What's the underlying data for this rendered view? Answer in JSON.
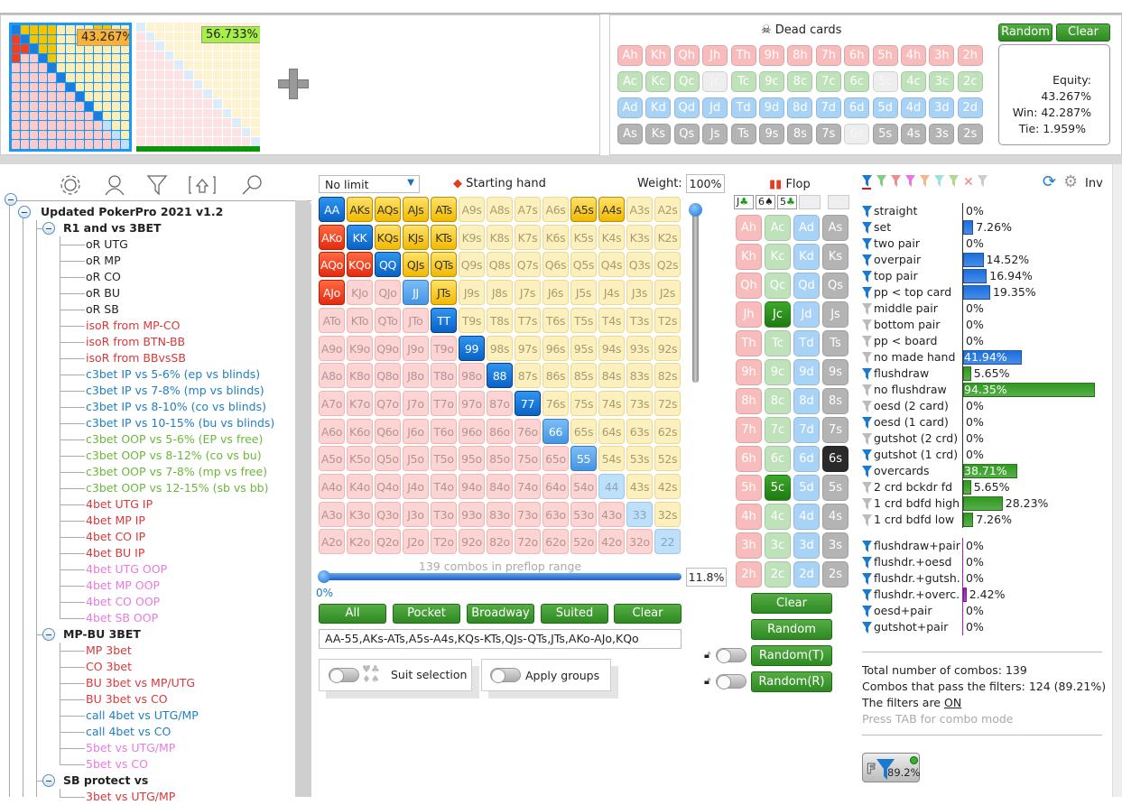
{
  "range_panel": {
    "hero_equity_label": "43.267%",
    "villain_equity_label": "56.733%",
    "add_icon": "plus-icon"
  },
  "dead_cards": {
    "title": "Dead cards",
    "icon": "skull-icon",
    "random_label": "Random",
    "clear_label": "Clear",
    "rows": [
      [
        "Ah",
        "Kh",
        "Qh",
        "Jh",
        "Th",
        "9h",
        "8h",
        "7h",
        "6h",
        "5h",
        "4h",
        "3h",
        "2h"
      ],
      [
        "Ac",
        "Kc",
        "Qc",
        "Jc",
        "Tc",
        "9c",
        "8c",
        "7c",
        "6c",
        "5c",
        "4c",
        "3c",
        "2c"
      ],
      [
        "Ad",
        "Kd",
        "Qd",
        "Jd",
        "Td",
        "9d",
        "8d",
        "7d",
        "6d",
        "5d",
        "4d",
        "3d",
        "2d"
      ],
      [
        "As",
        "Ks",
        "Qs",
        "Js",
        "Ts",
        "9s",
        "8s",
        "7s",
        "6s",
        "5s",
        "4s",
        "3s",
        "2s"
      ]
    ],
    "unavailable": [
      "Jc",
      "5c",
      "6s"
    ],
    "equity": "Equity: 43.267%",
    "win": "Win: 42.287%",
    "tie": "Tie: 1.959%"
  },
  "toolbar_icons": [
    "gear-icon",
    "user-icon",
    "filter-icon",
    "upload-icon",
    "search-icon"
  ],
  "tree": {
    "root": "Updated PokerPro 2021 v1.2",
    "groups": [
      {
        "label": "R1 and vs 3BET",
        "items": [
          {
            "t": "oR UTG",
            "c": "#222"
          },
          {
            "t": "oR MP",
            "c": "#222"
          },
          {
            "t": "oR CO",
            "c": "#222"
          },
          {
            "t": "oR BU",
            "c": "#222"
          },
          {
            "t": "oR SB",
            "c": "#222"
          },
          {
            "t": "isoR from MP-CO",
            "c": "#d9383a"
          },
          {
            "t": "isoR from BTN-BB",
            "c": "#d9383a"
          },
          {
            "t": "isoR from BBvsSB",
            "c": "#d9383a"
          },
          {
            "t": "c3bet IP vs 5-6% (ep vs blinds)",
            "c": "#1f7fc0"
          },
          {
            "t": "c3bet IP vs 7-8% (mp vs blinds)",
            "c": "#1f7fc0"
          },
          {
            "t": "c3bet IP vs 8-10% (co vs blinds)",
            "c": "#1f7fc0"
          },
          {
            "t": "c3bet IP vs 10-15% (bu vs blinds)",
            "c": "#1f7fc0"
          },
          {
            "t": "c3bet OOP vs 5-6% (EP vs free)",
            "c": "#6bb83a"
          },
          {
            "t": "c3bet OOP vs 8-12% (co vs bu)",
            "c": "#6bb83a"
          },
          {
            "t": "c3bet OOP vs 7-8% (mp vs free)",
            "c": "#6bb83a"
          },
          {
            "t": "c3bet OOP vs 12-15% (sb vs bb)",
            "c": "#6bb83a"
          },
          {
            "t": "4bet UTG IP",
            "c": "#d9383a"
          },
          {
            "t": "4bet MP IP",
            "c": "#d9383a"
          },
          {
            "t": "4bet CO IP",
            "c": "#d9383a"
          },
          {
            "t": "4bet BU IP",
            "c": "#d9383a"
          },
          {
            "t": "4bet UTG OOP",
            "c": "#e87ae0"
          },
          {
            "t": "4bet MP OOP",
            "c": "#e87ae0"
          },
          {
            "t": "4bet CO OOP",
            "c": "#e87ae0"
          },
          {
            "t": "4bet SB OOP",
            "c": "#e87ae0"
          }
        ]
      },
      {
        "label": "MP-BU 3BET",
        "items": [
          {
            "t": "MP 3bet",
            "c": "#d9383a"
          },
          {
            "t": "CO 3bet",
            "c": "#d9383a"
          },
          {
            "t": "BU 3bet vs MP/UTG",
            "c": "#d9383a"
          },
          {
            "t": "BU 3bet vs CO",
            "c": "#d9383a"
          },
          {
            "t": "call 4bet vs UTG/MP",
            "c": "#1f7fc0"
          },
          {
            "t": "call 4bet vs CO",
            "c": "#1f7fc0"
          },
          {
            "t": "5bet vs UTG/MP",
            "c": "#e87ae0"
          },
          {
            "t": "5bet vs CO",
            "c": "#e87ae0"
          }
        ]
      },
      {
        "label": "SB protect vs",
        "items": [
          {
            "t": "3bet vs UTG/MP",
            "c": "#d9383a"
          }
        ]
      }
    ]
  },
  "range_editor": {
    "limit_select": "No limit",
    "starting_hand_label": "Starting hand",
    "weight_label": "Weight:",
    "weight_value": "100%",
    "ranks": [
      "A",
      "K",
      "Q",
      "J",
      "T",
      "9",
      "8",
      "7",
      "6",
      "5",
      "4",
      "3",
      "2"
    ],
    "selected": [
      "AA",
      "KK",
      "QQ",
      "TT",
      "99",
      "88",
      "77",
      "AKs",
      "AQs",
      "AJs",
      "ATs",
      "A5s",
      "A4s",
      "KQs",
      "KJs",
      "KTs",
      "QJs",
      "QTs",
      "JTs",
      "AKo",
      "AQo",
      "KQo",
      "AJo"
    ],
    "partial": [
      "JJ",
      "66",
      "55"
    ],
    "combos_label": "139 combos in preflop range",
    "slider_value": "11.8%",
    "slider_min": "0%",
    "buttons": [
      "All",
      "Pocket",
      "Broadway",
      "Suited",
      "Clear"
    ],
    "range_text": "AA-55,AKs-ATs,A5s-A4s,KQs-KTs,QJs-QTs,JTs,AKo-AJo,KQo",
    "suit_selection_label": "Suit selection",
    "apply_groups_label": "Apply groups"
  },
  "flop": {
    "title": "Flop",
    "board": [
      {
        "r": "J",
        "s": "♣",
        "color": "#1a9a1a"
      },
      {
        "r": "6",
        "s": "♠",
        "color": "#222"
      },
      {
        "r": "5",
        "s": "♣",
        "color": "#1a9a1a"
      }
    ],
    "selected": [
      "Jc",
      "5c",
      "6s"
    ],
    "buttons": {
      "clear": "Clear",
      "random": "Random",
      "random_t": "Random(T)",
      "random_r": "Random(R)"
    }
  },
  "stats": {
    "inv_label": "Inv",
    "filter_colors": [
      "#1a7ad0",
      "#8ac88a",
      "#e89090",
      "#e07ae0",
      "#f0b890",
      "#a0e0e0",
      "#b0d890",
      "#f08080",
      "#cccccc"
    ],
    "groups": [
      {
        "color": "#1a6fe0",
        "rows": [
          {
            "label": "straight",
            "value": "0%",
            "pct": 0,
            "on": true
          },
          {
            "label": "set",
            "value": "7.26%",
            "pct": 7.26,
            "on": true
          },
          {
            "label": "two pair",
            "value": "0%",
            "pct": 0,
            "on": true
          },
          {
            "label": "overpair",
            "value": "14.52%",
            "pct": 14.52,
            "on": true
          },
          {
            "label": "top pair",
            "value": "16.94%",
            "pct": 16.94,
            "on": true
          },
          {
            "label": "pp < top card",
            "value": "19.35%",
            "pct": 19.35,
            "on": true
          },
          {
            "label": "middle pair",
            "value": "0%",
            "pct": 0,
            "on": false
          },
          {
            "label": "bottom pair",
            "value": "0%",
            "pct": 0,
            "on": false
          },
          {
            "label": "pp < board",
            "value": "0%",
            "pct": 0,
            "on": false
          },
          {
            "label": "no made hand",
            "value": "41.94%",
            "pct": 41.94,
            "on": false
          }
        ]
      },
      {
        "color": "#2e9a1e",
        "rows": [
          {
            "label": "flushdraw",
            "value": "5.65%",
            "pct": 5.65,
            "on": true
          },
          {
            "label": "no flushdraw",
            "value": "94.35%",
            "pct": 94.35,
            "on": false
          },
          {
            "label": "oesd (2 card)",
            "value": "0%",
            "pct": 0,
            "on": false
          },
          {
            "label": "oesd (1 card)",
            "value": "0%",
            "pct": 0,
            "on": true
          },
          {
            "label": "gutshot (2 crd)",
            "value": "0%",
            "pct": 0,
            "on": false
          },
          {
            "label": "gutshot (1 crd)",
            "value": "0%",
            "pct": 0,
            "on": true
          },
          {
            "label": "overcards",
            "value": "38.71%",
            "pct": 38.71,
            "on": true
          },
          {
            "label": "2 crd bckdr fd",
            "value": "5.65%",
            "pct": 5.65,
            "on": false
          },
          {
            "label": "1 crd bdfd high",
            "value": "28.23%",
            "pct": 28.23,
            "on": false
          },
          {
            "label": "1 crd bdfd low",
            "value": "7.26%",
            "pct": 7.26,
            "on": false
          }
        ]
      },
      {
        "color": "#a020c0",
        "rows": [
          {
            "label": "flushdraw+pair",
            "value": "0%",
            "pct": 0,
            "on": true
          },
          {
            "label": "flushdr.+oesd",
            "value": "0%",
            "pct": 0,
            "on": true
          },
          {
            "label": "flushdr.+gutsh.",
            "value": "0%",
            "pct": 0,
            "on": true
          },
          {
            "label": "flushdr.+overc.",
            "value": "2.42%",
            "pct": 2.42,
            "on": true
          },
          {
            "label": "oesd+pair",
            "value": "0%",
            "pct": 0,
            "on": true
          },
          {
            "label": "gutshot+pair",
            "value": "0%",
            "pct": 0,
            "on": true
          }
        ]
      }
    ],
    "total": "Total number of combos: 139",
    "pass": "Combos that pass the filters: 124 (89.21%)",
    "filters_prefix": "The filters are ",
    "filters_state": "ON",
    "hint": "Press TAB for combo mode",
    "filter_button": "89.2%",
    "filter_letter": "F"
  }
}
